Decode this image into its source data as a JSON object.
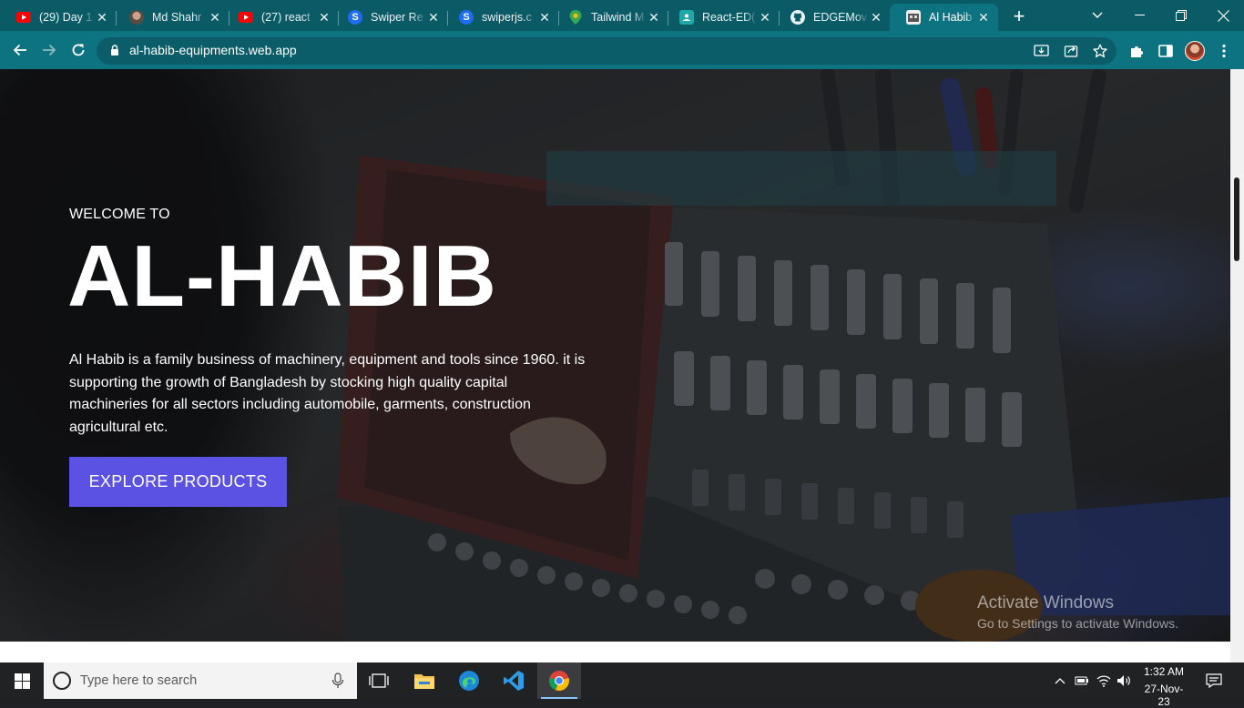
{
  "browser": {
    "tabs": [
      {
        "title": "(29) Day 1",
        "favicon": "youtube-icon"
      },
      {
        "title": "Md Shahr",
        "favicon": "profile-photo-icon"
      },
      {
        "title": "(27) react",
        "favicon": "youtube-icon"
      },
      {
        "title": "Swiper Re",
        "favicon": "swiper-icon"
      },
      {
        "title": "swiperjs.c",
        "favicon": "swiper-icon"
      },
      {
        "title": "Tailwind M",
        "favicon": "maps-pin-icon"
      },
      {
        "title": "React-ED(",
        "favicon": "classroom-icon"
      },
      {
        "title": "EDGEMov",
        "favicon": "github-icon"
      },
      {
        "title": "Al Habib",
        "favicon": "site-icon",
        "active": true
      }
    ],
    "url": "al-habib-equipments.web.app"
  },
  "hero": {
    "kicker": "WELCOME TO",
    "title": "AL-HABIB",
    "description": "Al Habib is a family business of machinery, equipment and tools since 1960. it is supporting the growth of Bangladesh by stocking high quality capital machineries for all sectors including automobile, garments, construction agricultural etc.",
    "cta": "EXPLORE PRODUCTS"
  },
  "watermark": {
    "line1": "Activate Windows",
    "line2": "Go to Settings to activate Windows."
  },
  "taskbar": {
    "search_placeholder": "Type here to search",
    "time": "1:32 AM",
    "date": "27-Nov-23"
  },
  "colors": {
    "browser_tabstrip": "#0b5b66",
    "browser_toolbar": "#0e7380",
    "cta_button": "#5b52e3"
  }
}
